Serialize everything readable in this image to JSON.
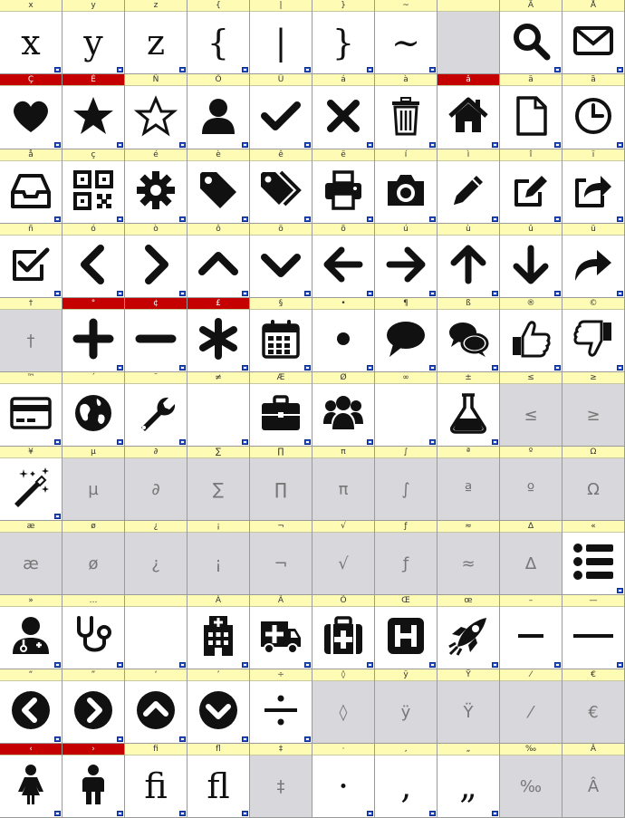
{
  "rows": [
    [
      {
        "label": "x",
        "glyph": "x",
        "kind": "char"
      },
      {
        "label": "y",
        "glyph": "y",
        "kind": "char"
      },
      {
        "label": "z",
        "glyph": "z",
        "kind": "char"
      },
      {
        "label": "{",
        "glyph": "{",
        "kind": "char"
      },
      {
        "label": "|",
        "glyph": "|",
        "kind": "char"
      },
      {
        "label": "}",
        "glyph": "}",
        "kind": "char"
      },
      {
        "label": "~",
        "glyph": "~",
        "kind": "char"
      },
      {
        "label": "",
        "glyph": "",
        "kind": "empty"
      },
      {
        "label": "Ä",
        "icon": "search-icon",
        "kind": "icon"
      },
      {
        "label": "Å",
        "icon": "envelope-icon",
        "kind": "icon"
      }
    ],
    [
      {
        "label": "Ç",
        "icon": "heart-icon",
        "kind": "icon",
        "red": true
      },
      {
        "label": "É",
        "icon": "star-icon",
        "kind": "icon",
        "red": true
      },
      {
        "label": "Ñ",
        "icon": "star-outline-icon",
        "kind": "icon"
      },
      {
        "label": "Ö",
        "icon": "user-icon",
        "kind": "icon"
      },
      {
        "label": "Ü",
        "icon": "check-icon",
        "kind": "icon"
      },
      {
        "label": "á",
        "icon": "times-icon",
        "kind": "icon"
      },
      {
        "label": "à",
        "icon": "trash-icon",
        "kind": "icon"
      },
      {
        "label": "â",
        "icon": "home-icon",
        "kind": "icon",
        "red": true
      },
      {
        "label": "ä",
        "icon": "file-icon",
        "kind": "icon"
      },
      {
        "label": "ã",
        "icon": "clock-icon",
        "kind": "icon"
      }
    ],
    [
      {
        "label": "å",
        "icon": "inbox-icon",
        "kind": "icon"
      },
      {
        "label": "ç",
        "icon": "qrcode-icon",
        "kind": "icon"
      },
      {
        "label": "é",
        "icon": "cog-icon",
        "kind": "icon"
      },
      {
        "label": "è",
        "icon": "tag-icon",
        "kind": "icon"
      },
      {
        "label": "ê",
        "icon": "tags-icon",
        "kind": "icon"
      },
      {
        "label": "ë",
        "icon": "print-icon",
        "kind": "icon"
      },
      {
        "label": "í",
        "icon": "camera-icon",
        "kind": "icon"
      },
      {
        "label": "ì",
        "icon": "pencil-icon",
        "kind": "icon"
      },
      {
        "label": "î",
        "icon": "edit-icon",
        "kind": "icon"
      },
      {
        "label": "ï",
        "icon": "share-square-icon",
        "kind": "icon"
      }
    ],
    [
      {
        "label": "ñ",
        "icon": "check-square-icon",
        "kind": "icon"
      },
      {
        "label": "ó",
        "icon": "chevron-left-icon",
        "kind": "icon"
      },
      {
        "label": "ò",
        "icon": "chevron-right-icon",
        "kind": "icon"
      },
      {
        "label": "ô",
        "icon": "chevron-up-icon",
        "kind": "icon"
      },
      {
        "label": "ö",
        "icon": "chevron-down-icon",
        "kind": "icon"
      },
      {
        "label": "õ",
        "icon": "arrow-left-icon",
        "kind": "icon"
      },
      {
        "label": "ú",
        "icon": "arrow-right-icon",
        "kind": "icon"
      },
      {
        "label": "ù",
        "icon": "arrow-up-icon",
        "kind": "icon"
      },
      {
        "label": "û",
        "icon": "arrow-down-icon",
        "kind": "icon"
      },
      {
        "label": "ü",
        "icon": "share-icon",
        "kind": "icon"
      }
    ],
    [
      {
        "label": "†",
        "glyph": "†",
        "kind": "gray"
      },
      {
        "label": "°",
        "icon": "plus-icon",
        "kind": "icon",
        "red": true
      },
      {
        "label": "¢",
        "icon": "minus-icon",
        "kind": "icon",
        "red": true
      },
      {
        "label": "£",
        "icon": "asterisk-icon",
        "kind": "icon",
        "red": true
      },
      {
        "label": "§",
        "icon": "calendar-icon",
        "kind": "icon"
      },
      {
        "label": "•",
        "icon": "circle-small-icon",
        "kind": "icon"
      },
      {
        "label": "¶",
        "icon": "comment-icon",
        "kind": "icon"
      },
      {
        "label": "ß",
        "icon": "comments-icon",
        "kind": "icon"
      },
      {
        "label": "®",
        "icon": "thumbs-up-icon",
        "kind": "icon"
      },
      {
        "label": "©",
        "icon": "thumbs-down-icon",
        "kind": "icon"
      }
    ],
    [
      {
        "label": "™",
        "icon": "credit-card-icon",
        "kind": "icon"
      },
      {
        "label": "´",
        "icon": "globe-icon",
        "kind": "icon"
      },
      {
        "label": "¨",
        "icon": "wrench-icon",
        "kind": "icon"
      },
      {
        "label": "≠",
        "glyph": "",
        "kind": "blank"
      },
      {
        "label": "Æ",
        "icon": "briefcase-icon",
        "kind": "icon"
      },
      {
        "label": "Ø",
        "icon": "users-icon",
        "kind": "icon"
      },
      {
        "label": "∞",
        "glyph": "",
        "kind": "blank"
      },
      {
        "label": "±",
        "icon": "flask-icon",
        "kind": "icon"
      },
      {
        "label": "≤",
        "glyph": "≤",
        "kind": "gray"
      },
      {
        "label": "≥",
        "glyph": "≥",
        "kind": "gray"
      }
    ],
    [
      {
        "label": "¥",
        "icon": "magic-icon",
        "kind": "icon"
      },
      {
        "label": "µ",
        "glyph": "µ",
        "kind": "gray"
      },
      {
        "label": "∂",
        "glyph": "∂",
        "kind": "gray"
      },
      {
        "label": "∑",
        "glyph": "∑",
        "kind": "gray"
      },
      {
        "label": "∏",
        "glyph": "∏",
        "kind": "gray"
      },
      {
        "label": "π",
        "glyph": "π",
        "kind": "gray"
      },
      {
        "label": "∫",
        "glyph": "∫",
        "kind": "gray"
      },
      {
        "label": "ª",
        "glyph": "ª",
        "kind": "gray"
      },
      {
        "label": "º",
        "glyph": "º",
        "kind": "gray"
      },
      {
        "label": "Ω",
        "glyph": "Ω",
        "kind": "gray"
      }
    ],
    [
      {
        "label": "æ",
        "glyph": "æ",
        "kind": "gray"
      },
      {
        "label": "ø",
        "glyph": "ø",
        "kind": "gray"
      },
      {
        "label": "¿",
        "glyph": "¿",
        "kind": "gray"
      },
      {
        "label": "¡",
        "glyph": "¡",
        "kind": "gray"
      },
      {
        "label": "¬",
        "glyph": "¬",
        "kind": "gray"
      },
      {
        "label": "√",
        "glyph": "√",
        "kind": "gray"
      },
      {
        "label": "ƒ",
        "glyph": "ƒ",
        "kind": "gray"
      },
      {
        "label": "≈",
        "glyph": "≈",
        "kind": "gray"
      },
      {
        "label": "∆",
        "glyph": "∆",
        "kind": "gray"
      },
      {
        "label": "«",
        "icon": "list-icon",
        "kind": "icon"
      }
    ],
    [
      {
        "label": "»",
        "icon": "user-md-icon",
        "kind": "icon"
      },
      {
        "label": "…",
        "icon": "stethoscope-icon",
        "kind": "icon"
      },
      {
        "label": " ",
        "glyph": "",
        "kind": "blank"
      },
      {
        "label": "À",
        "icon": "hospital-icon",
        "kind": "icon"
      },
      {
        "label": "Ã",
        "icon": "ambulance-icon",
        "kind": "icon"
      },
      {
        "label": "Õ",
        "icon": "medkit-icon",
        "kind": "icon"
      },
      {
        "label": "Œ",
        "icon": "h-square-icon",
        "kind": "icon"
      },
      {
        "label": "œ",
        "icon": "rocket-icon",
        "kind": "icon"
      },
      {
        "label": "–",
        "icon": "en-dash-icon",
        "kind": "icon"
      },
      {
        "label": "—",
        "icon": "em-dash-icon",
        "kind": "icon"
      }
    ],
    [
      {
        "label": "“",
        "icon": "chevron-circle-left-icon",
        "kind": "icon"
      },
      {
        "label": "”",
        "icon": "chevron-circle-right-icon",
        "kind": "icon"
      },
      {
        "label": "‘",
        "icon": "chevron-circle-up-icon",
        "kind": "icon"
      },
      {
        "label": "’",
        "icon": "chevron-circle-down-icon",
        "kind": "icon"
      },
      {
        "label": "÷",
        "icon": "divide-icon",
        "kind": "icon"
      },
      {
        "label": "◊",
        "glyph": "◊",
        "kind": "gray"
      },
      {
        "label": "ÿ",
        "glyph": "ÿ",
        "kind": "gray"
      },
      {
        "label": "Ÿ",
        "glyph": "Ÿ",
        "kind": "gray"
      },
      {
        "label": "⁄",
        "glyph": "⁄",
        "kind": "gray"
      },
      {
        "label": "€",
        "glyph": "€",
        "kind": "gray"
      }
    ],
    [
      {
        "label": "‹",
        "icon": "female-icon",
        "kind": "icon",
        "red": true
      },
      {
        "label": "›",
        "icon": "male-icon",
        "kind": "icon",
        "red": true
      },
      {
        "label": "ﬁ",
        "glyph": "ﬁ",
        "kind": "char"
      },
      {
        "label": "ﬂ",
        "glyph": "ﬂ",
        "kind": "char"
      },
      {
        "label": "‡",
        "glyph": "‡",
        "kind": "gray"
      },
      {
        "label": "·",
        "glyph": "·",
        "kind": "char"
      },
      {
        "label": "‚",
        "glyph": "‚",
        "kind": "char"
      },
      {
        "label": "„",
        "glyph": "„",
        "kind": "char"
      },
      {
        "label": "‰",
        "glyph": "‰",
        "kind": "gray"
      },
      {
        "label": "Â",
        "glyph": "Â",
        "kind": "gray"
      }
    ]
  ],
  "colors": {
    "header": "#fdfbb4",
    "header_red": "#c40000",
    "empty": "#d8d8dc",
    "marker": "#2a55d4"
  }
}
